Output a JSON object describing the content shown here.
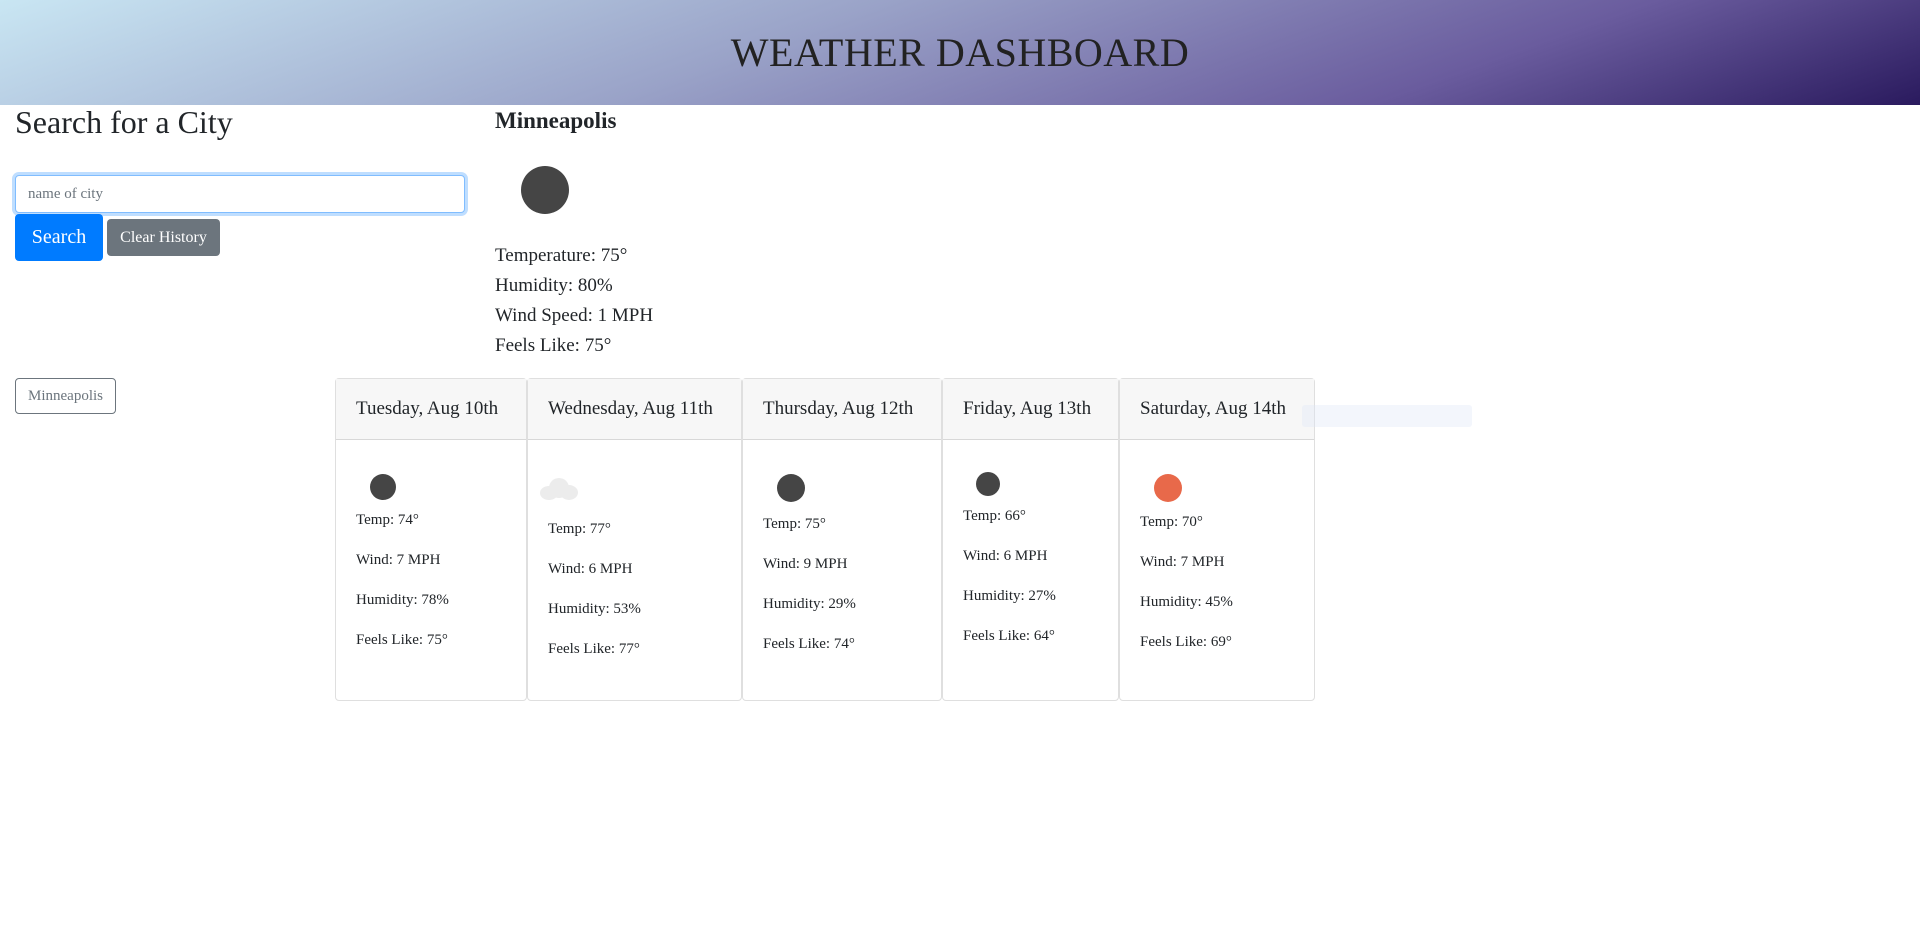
{
  "header": {
    "title": "WEATHER DASHBOARD"
  },
  "search": {
    "title": "Search for a City",
    "placeholder": "name of city",
    "search_label": "Search",
    "clear_label": "Clear History"
  },
  "history": [
    "Minneapolis"
  ],
  "current": {
    "city": "Minneapolis",
    "icon": "weather-icon",
    "temperature": "Temperature: 75°",
    "humidity": "Humidity: 80%",
    "wind": "Wind Speed: 1 MPH",
    "feels": "Feels Like: 75°"
  },
  "forecast": [
    {
      "day": "Tuesday, Aug 10th",
      "icon": "weather-dot-icon",
      "temp": "Temp: 74°",
      "wind": "Wind: 7 MPH",
      "humidity": "Humidity: 78%",
      "feels": "Feels Like: 75°"
    },
    {
      "day": "Wednesday, Aug 11th",
      "icon": "cloud-icon",
      "temp": "Temp: 77°",
      "wind": "Wind: 6 MPH",
      "humidity": "Humidity: 53%",
      "feels": "Feels Like: 77°"
    },
    {
      "day": "Thursday, Aug 12th",
      "icon": "weather-dot-icon",
      "temp": "Temp: 75°",
      "wind": "Wind: 9 MPH",
      "humidity": "Humidity: 29%",
      "feels": "Feels Like: 74°"
    },
    {
      "day": "Friday, Aug 13th",
      "icon": "weather-dot-icon",
      "temp": "Temp: 66°",
      "wind": "Wind: 6 MPH",
      "humidity": "Humidity: 27%",
      "feels": "Feels Like: 64°"
    },
    {
      "day": "Saturday, Aug 14th",
      "icon": "sun-icon",
      "temp": "Temp: 70°",
      "wind": "Wind: 7 MPH",
      "humidity": "Humidity: 45%",
      "feels": "Feels Like: 69°"
    }
  ],
  "colors": {
    "primary": "#007bff",
    "secondary": "#6c757d",
    "sun": "#e8694a"
  }
}
